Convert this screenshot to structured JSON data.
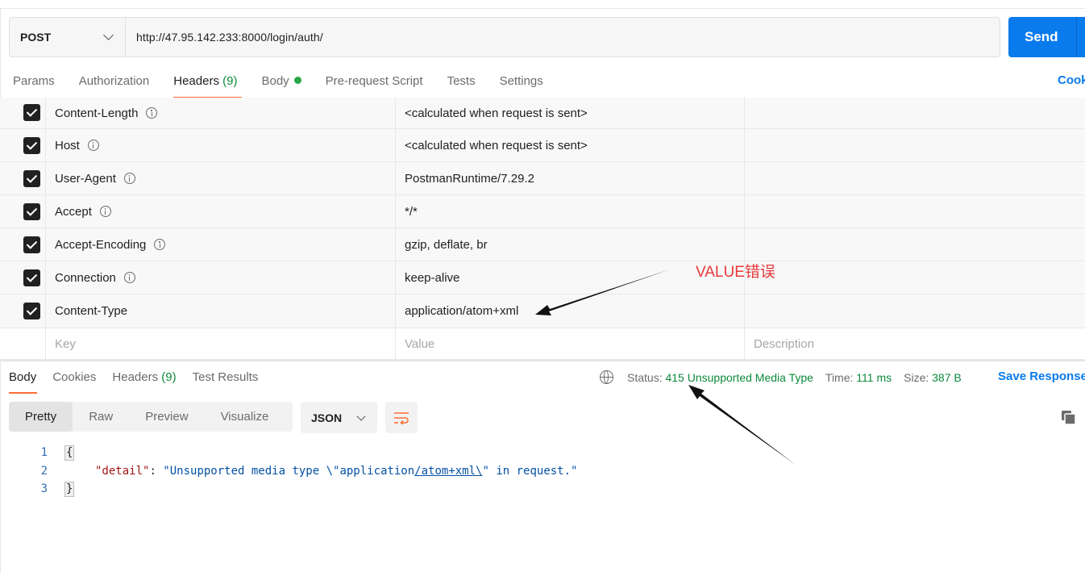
{
  "request": {
    "method": "POST",
    "url": "http://47.95.142.233:8000/login/auth/",
    "send_label": "Send"
  },
  "request_tabs": {
    "params": "Params",
    "authorization": "Authorization",
    "headers": "Headers",
    "headers_count": "(9)",
    "body": "Body",
    "pre_request": "Pre-request Script",
    "tests": "Tests",
    "settings": "Settings",
    "cookies": "Cookies"
  },
  "headers_table": {
    "rows": [
      {
        "key": "Content-Length",
        "value": "<calculated when request is sent>",
        "checked": true,
        "info": true
      },
      {
        "key": "Host",
        "value": "<calculated when request is sent>",
        "checked": true,
        "info": true
      },
      {
        "key": "User-Agent",
        "value": "PostmanRuntime/7.29.2",
        "checked": true,
        "info": true
      },
      {
        "key": "Accept",
        "value": "*/*",
        "checked": true,
        "info": true
      },
      {
        "key": "Accept-Encoding",
        "value": "gzip, deflate, br",
        "checked": true,
        "info": true
      },
      {
        "key": "Connection",
        "value": "keep-alive",
        "checked": true,
        "info": true
      },
      {
        "key": "Content-Type",
        "value": "application/atom+xml",
        "checked": true,
        "info": false
      }
    ],
    "placeholder": {
      "key": "Key",
      "value": "Value",
      "description": "Description"
    }
  },
  "response_tabs": {
    "body": "Body",
    "cookies": "Cookies",
    "headers": "Headers",
    "headers_count": "(9)",
    "test_results": "Test Results"
  },
  "response_status": {
    "status_label": "Status:",
    "status_value": "415 Unsupported Media Type",
    "time_label": "Time:",
    "time_value": "111 ms",
    "size_label": "Size:",
    "size_value": "387 B",
    "save_response": "Save Response"
  },
  "view_options": {
    "pretty": "Pretty",
    "raw": "Raw",
    "preview": "Preview",
    "visualize": "Visualize",
    "format": "JSON"
  },
  "code": {
    "line_numbers": [
      "1",
      "2",
      "3"
    ],
    "open_brace": "{",
    "close_brace": "}",
    "key": "\"detail\"",
    "colon": ": ",
    "value_start": "\"Unsupported media type \\\"application",
    "value_underlined": "/atom+xml\\",
    "value_end": "\" in request.\""
  },
  "annotation": {
    "text": "VALUE错误",
    "color": "#e8393b"
  },
  "colors": {
    "accent_blue": "#097bed",
    "tab_underline": "#ff6c37",
    "status_green": "#0c8a3b"
  },
  "icons": {
    "method_dropdown": "chevron-down-icon",
    "info": "info-circle-icon",
    "checkbox": "checkbox-checked-icon",
    "globe": "globe-icon",
    "wrap": "wrap-lines-icon",
    "copy": "copy-icon"
  }
}
